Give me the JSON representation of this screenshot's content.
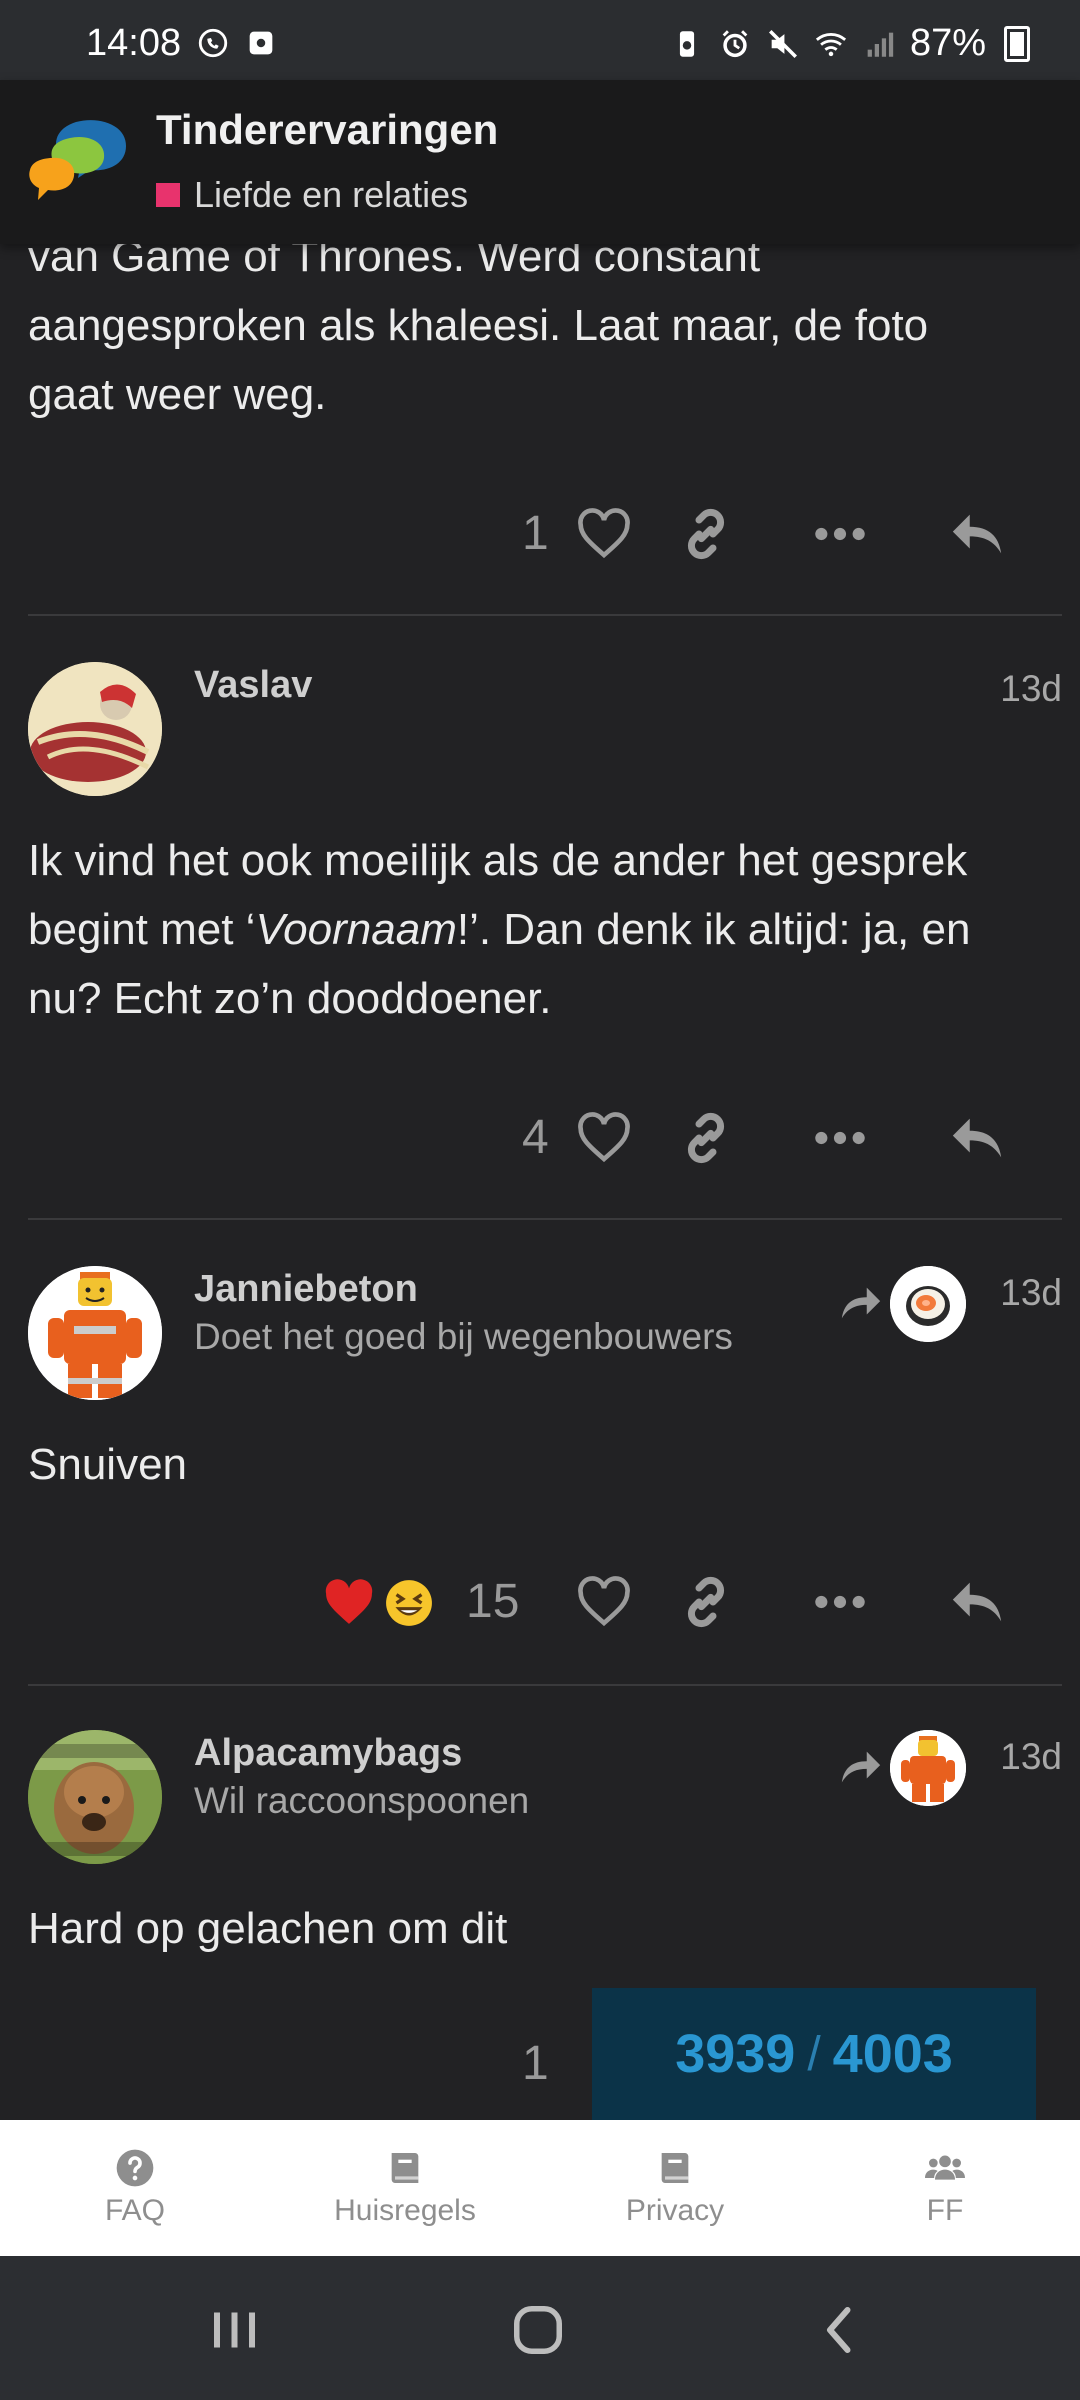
{
  "status_bar": {
    "time": "14:08",
    "battery": "87%"
  },
  "header": {
    "title": "Tinderervaringen",
    "category": "Liefde en relaties",
    "category_color": "#e8336d"
  },
  "posts": [
    {
      "text_lines": [
        "van Game of Thrones. Werd constant",
        "aangesproken als khaleesi. Laat maar, de foto",
        "gaat weer weg."
      ],
      "likes": "1"
    },
    {
      "username": "Vaslav",
      "date": "13d",
      "text_parts": [
        "Ik vind het ook moeilijk als de ander het gesprek begint met ‘",
        "Voornaam",
        "!’. Dan denk ik altijd: ja, en nu? Echt zo’n dooddoener."
      ],
      "likes": "4"
    },
    {
      "username": "Janniebeton",
      "user_title": "Doet het goed bij wegenbouwers",
      "date": "13d",
      "text": "Snuiven",
      "likes": "15",
      "reactions": [
        "heart-emoji",
        "laughing-emoji"
      ]
    },
    {
      "username": "Alpacamybags",
      "user_title": "Wil raccoonspoonen",
      "date": "13d",
      "text": "Hard op gelachen om dit",
      "likes": "1"
    }
  ],
  "progress": {
    "current": "3939",
    "separator": "/",
    "total": "4003"
  },
  "footer_nav": [
    {
      "label": "FAQ",
      "icon": "question-circle-icon"
    },
    {
      "label": "Huisregels",
      "icon": "book-icon"
    },
    {
      "label": "Privacy",
      "icon": "book-icon"
    },
    {
      "label": "FF",
      "icon": "users-icon"
    }
  ],
  "colors": {
    "background": "#222224",
    "accent": "#2a97d2",
    "progress_bg": "#0b3348"
  }
}
